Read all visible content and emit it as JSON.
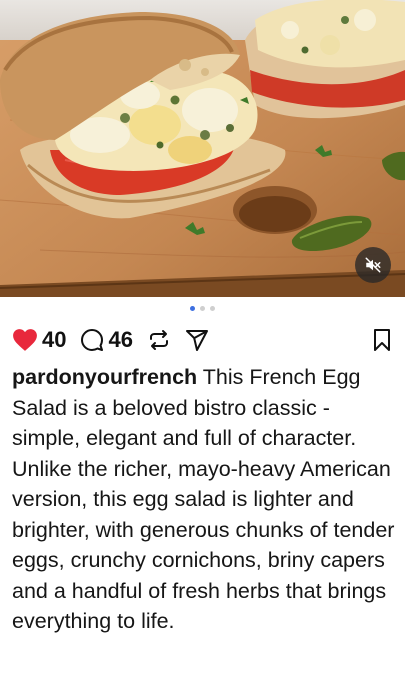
{
  "post": {
    "likes": "40",
    "comments": "46",
    "username": "pardonyourfrench",
    "caption": "This French Egg Salad is a beloved bistro classic - simple, elegant and full of character. Unlike the richer, mayo-heavy American version, this egg salad is lighter and brighter, with generous chunks of tender eggs, crunchy cornichons, briny capers and a handful of fresh herbs that brings everything to life."
  },
  "carousel": {
    "active_index": 1,
    "total": 3
  },
  "icons": {
    "like": "heart-filled-icon",
    "comment": "comment-bubble-icon",
    "repost": "repost-icon",
    "share": "paper-plane-icon",
    "save": "bookmark-icon",
    "mute": "speaker-muted-icon"
  },
  "colors": {
    "like": "#e8283c",
    "dot_active": "#3d6fe0",
    "dot_inactive": "#cfcfcf"
  }
}
